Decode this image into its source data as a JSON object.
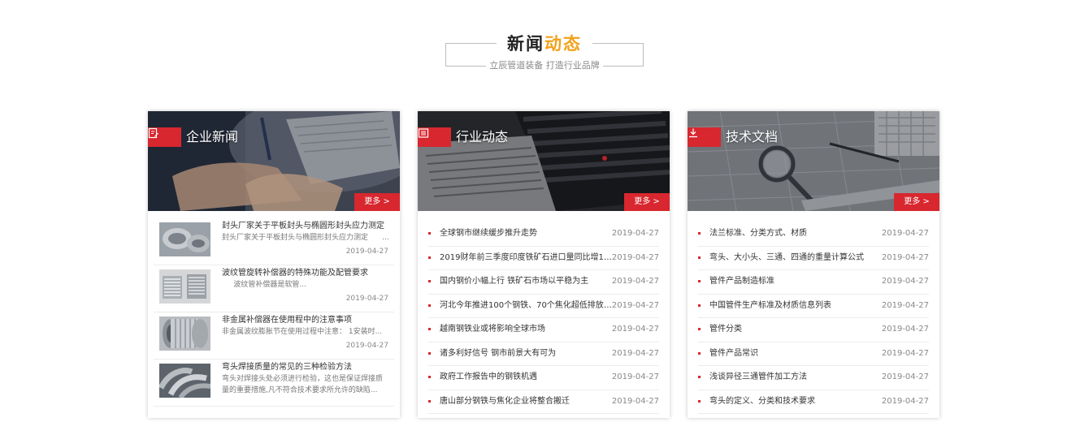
{
  "section": {
    "title_a": "新闻",
    "title_b": "动态",
    "subtitle": "立辰管道装备 打造行业品牌"
  },
  "colors": {
    "accent": "#d8272f",
    "gold": "#f0a21a"
  },
  "cards": [
    {
      "label": "企业新闻",
      "icon": "edit-document-icon",
      "more": "更多 >",
      "items": [
        {
          "title": "封头厂家关于平板封头与椭圆形封头应力测定",
          "desc": "封头厂家关于平板封头与椭圆形封头应力测定      ...",
          "date": "2019-04-27"
        },
        {
          "title": "波纹管旋转补偿器的特殊功能及配管要求",
          "desc": "     波纹管补偿器是软管...",
          "date": "2019-04-27"
        },
        {
          "title": "非金属补偿器在使用程中的注意事项",
          "desc": "非金属波纹膨胀节在使用过程中注意： 1安装时...",
          "date": "2019-04-27"
        },
        {
          "title": "弯头焊接质量的常见的三种检验方法",
          "desc": "弯头对焊接头处必须进行检验，这也是保证焊接质量的重要措施,凡不符合技术要求所允许的缺陷...",
          "date": ""
        }
      ]
    },
    {
      "label": "行业动态",
      "icon": "newspaper-icon",
      "more": "更多 >",
      "items": [
        {
          "title": "全球钢市继续缓步推升走势",
          "date": "2019-04-27"
        },
        {
          "title": "2019财年前三季度印度铁矿石进口量同比增15...",
          "date": "2019-04-27"
        },
        {
          "title": "国内钢价小幅上行 铁矿石市场以平稳为主",
          "date": "2019-04-27"
        },
        {
          "title": "河北今年推进100个钢铁、70个焦化超低排放改...",
          "date": "2019-04-27"
        },
        {
          "title": "越南钢铁业或将影响全球市场",
          "date": "2019-04-27"
        },
        {
          "title": "诸多利好信号 钢市前景大有可为",
          "date": "2019-04-27"
        },
        {
          "title": "政府工作报告中的钢铁机遇",
          "date": "2019-04-27"
        },
        {
          "title": "唐山部分钢铁与焦化企业将整合搬迁",
          "date": "2019-04-27"
        }
      ]
    },
    {
      "label": "技术文档",
      "icon": "download-icon",
      "more": "更多 >",
      "items": [
        {
          "title": "法兰标准、分类方式、材质",
          "date": "2019-04-27"
        },
        {
          "title": "弯头、大小头、三通、四通的重量计算公式",
          "date": "2019-04-27"
        },
        {
          "title": "管件产品制造标准",
          "date": "2019-04-27"
        },
        {
          "title": "中国管件生产标准及材质信息列表",
          "date": "2019-04-27"
        },
        {
          "title": "管件分类",
          "date": "2019-04-27"
        },
        {
          "title": "管件产品常识",
          "date": "2019-04-27"
        },
        {
          "title": "浅谈异径三通管件加工方法",
          "date": "2019-04-27"
        },
        {
          "title": "弯头的定义、分类和技术要求",
          "date": "2019-04-27"
        }
      ]
    }
  ]
}
